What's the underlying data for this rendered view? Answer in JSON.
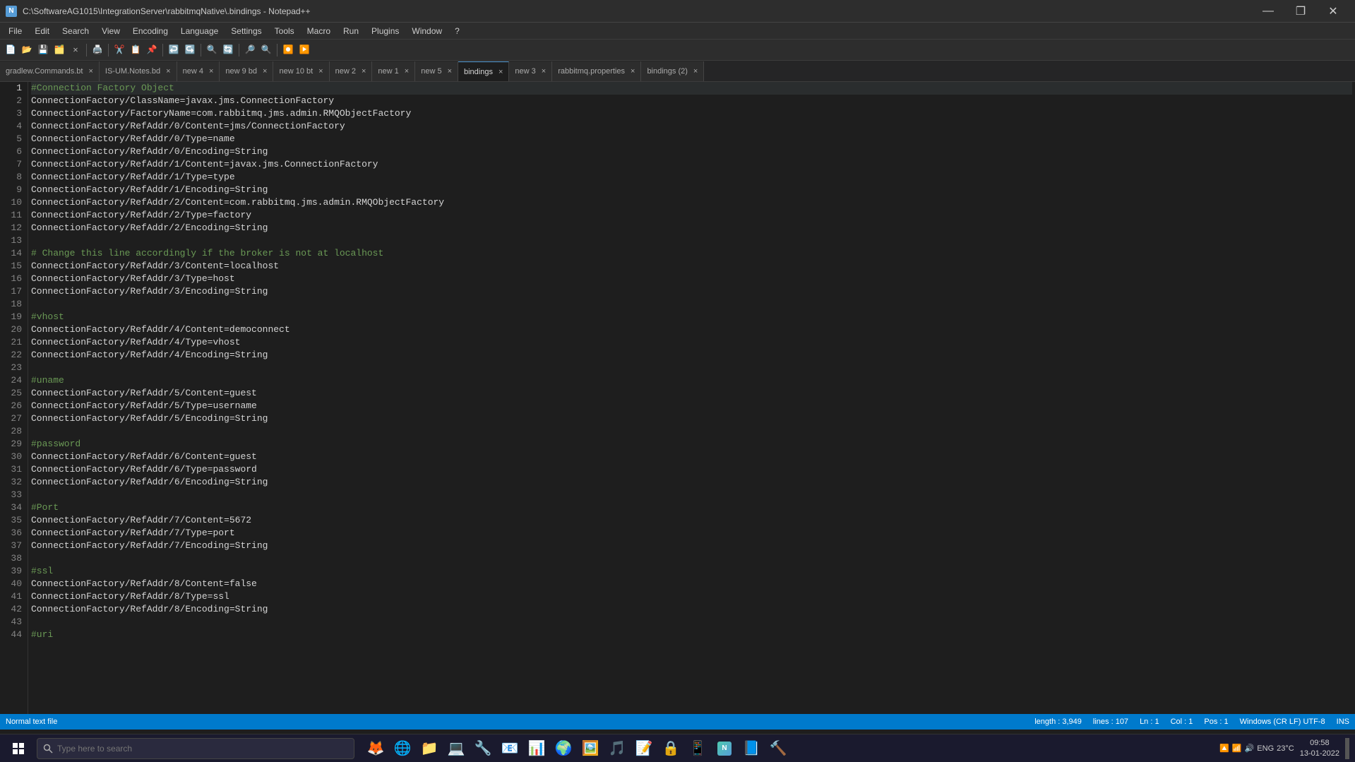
{
  "titleBar": {
    "title": "C:\\SoftwareAG1015\\IntegrationServer\\rabbitmqNative\\.bindings - Notepad++",
    "icon": "N",
    "minimize": "—",
    "maximize": "❐",
    "close": "✕"
  },
  "menuBar": {
    "items": [
      "File",
      "Edit",
      "Search",
      "View",
      "Encoding",
      "Language",
      "Settings",
      "Tools",
      "Macro",
      "Run",
      "Plugins",
      "Window",
      "?"
    ]
  },
  "tabs": [
    {
      "label": "gradlew.Commands.bt",
      "active": false,
      "closable": true
    },
    {
      "label": "IS-UM.Notes.bd",
      "active": false,
      "closable": true
    },
    {
      "label": "new 4",
      "active": false,
      "closable": true
    },
    {
      "label": "new 9 bd",
      "active": false,
      "closable": true
    },
    {
      "label": "new 10 bt",
      "active": false,
      "closable": true
    },
    {
      "label": "new 2",
      "active": false,
      "closable": true
    },
    {
      "label": "new 1",
      "active": false,
      "closable": true
    },
    {
      "label": "new 5",
      "active": false,
      "closable": true
    },
    {
      "label": "bindings",
      "active": true,
      "closable": true
    },
    {
      "label": "new 3",
      "active": false,
      "closable": true
    },
    {
      "label": "rabbitmq.properties",
      "active": false,
      "closable": true
    },
    {
      "label": "bindings (2)",
      "active": false,
      "closable": true
    }
  ],
  "codeLines": [
    {
      "num": 1,
      "text": "#Connection Factory Object",
      "type": "comment"
    },
    {
      "num": 2,
      "text": "ConnectionFactory/ClassName=javax.jms.ConnectionFactory",
      "type": "normal"
    },
    {
      "num": 3,
      "text": "ConnectionFactory/FactoryName=com.rabbitmq.jms.admin.RMQObjectFactory",
      "type": "normal"
    },
    {
      "num": 4,
      "text": "ConnectionFactory/RefAddr/0/Content=jms/ConnectionFactory",
      "type": "normal"
    },
    {
      "num": 5,
      "text": "ConnectionFactory/RefAddr/0/Type=name",
      "type": "normal"
    },
    {
      "num": 6,
      "text": "ConnectionFactory/RefAddr/0/Encoding=String",
      "type": "normal"
    },
    {
      "num": 7,
      "text": "ConnectionFactory/RefAddr/1/Content=javax.jms.ConnectionFactory",
      "type": "normal"
    },
    {
      "num": 8,
      "text": "ConnectionFactory/RefAddr/1/Type=type",
      "type": "normal"
    },
    {
      "num": 9,
      "text": "ConnectionFactory/RefAddr/1/Encoding=String",
      "type": "normal"
    },
    {
      "num": 10,
      "text": "ConnectionFactory/RefAddr/2/Content=com.rabbitmq.jms.admin.RMQObjectFactory",
      "type": "normal"
    },
    {
      "num": 11,
      "text": "ConnectionFactory/RefAddr/2/Type=factory",
      "type": "normal"
    },
    {
      "num": 12,
      "text": "ConnectionFactory/RefAddr/2/Encoding=String",
      "type": "normal"
    },
    {
      "num": 13,
      "text": "",
      "type": "normal"
    },
    {
      "num": 14,
      "text": "# Change this line accordingly if the broker is not at localhost",
      "type": "comment"
    },
    {
      "num": 15,
      "text": "ConnectionFactory/RefAddr/3/Content=localhost",
      "type": "normal"
    },
    {
      "num": 16,
      "text": "ConnectionFactory/RefAddr/3/Type=host",
      "type": "normal"
    },
    {
      "num": 17,
      "text": "ConnectionFactory/RefAddr/3/Encoding=String",
      "type": "normal"
    },
    {
      "num": 18,
      "text": "",
      "type": "normal"
    },
    {
      "num": 19,
      "text": "#vhost",
      "type": "comment"
    },
    {
      "num": 20,
      "text": "ConnectionFactory/RefAddr/4/Content=democonnect",
      "type": "normal"
    },
    {
      "num": 21,
      "text": "ConnectionFactory/RefAddr/4/Type=vhost",
      "type": "normal"
    },
    {
      "num": 22,
      "text": "ConnectionFactory/RefAddr/4/Encoding=String",
      "type": "normal"
    },
    {
      "num": 23,
      "text": "",
      "type": "normal"
    },
    {
      "num": 24,
      "text": "#uname",
      "type": "comment"
    },
    {
      "num": 25,
      "text": "ConnectionFactory/RefAddr/5/Content=guest",
      "type": "normal"
    },
    {
      "num": 26,
      "text": "ConnectionFactory/RefAddr/5/Type=username",
      "type": "normal"
    },
    {
      "num": 27,
      "text": "ConnectionFactory/RefAddr/5/Encoding=String",
      "type": "normal"
    },
    {
      "num": 28,
      "text": "",
      "type": "normal"
    },
    {
      "num": 29,
      "text": "#password",
      "type": "comment"
    },
    {
      "num": 30,
      "text": "ConnectionFactory/RefAddr/6/Content=guest",
      "type": "normal"
    },
    {
      "num": 31,
      "text": "ConnectionFactory/RefAddr/6/Type=password",
      "type": "normal"
    },
    {
      "num": 32,
      "text": "ConnectionFactory/RefAddr/6/Encoding=String",
      "type": "normal"
    },
    {
      "num": 33,
      "text": "",
      "type": "normal"
    },
    {
      "num": 34,
      "text": "#Port",
      "type": "comment"
    },
    {
      "num": 35,
      "text": "ConnectionFactory/RefAddr/7/Content=5672",
      "type": "normal"
    },
    {
      "num": 36,
      "text": "ConnectionFactory/RefAddr/7/Type=port",
      "type": "normal"
    },
    {
      "num": 37,
      "text": "ConnectionFactory/RefAddr/7/Encoding=String",
      "type": "normal"
    },
    {
      "num": 38,
      "text": "",
      "type": "normal"
    },
    {
      "num": 39,
      "text": "#ssl",
      "type": "comment"
    },
    {
      "num": 40,
      "text": "ConnectionFactory/RefAddr/8/Content=false",
      "type": "normal"
    },
    {
      "num": 41,
      "text": "ConnectionFactory/RefAddr/8/Type=ssl",
      "type": "normal"
    },
    {
      "num": 42,
      "text": "ConnectionFactory/RefAddr/8/Encoding=String",
      "type": "normal"
    },
    {
      "num": 43,
      "text": "",
      "type": "normal"
    },
    {
      "num": 44,
      "text": "#uri",
      "type": "comment"
    }
  ],
  "statusBar": {
    "fileType": "Normal text file",
    "length": "length : 3,949",
    "lines": "lines : 107",
    "ln": "Ln : 1",
    "col": "Col : 1",
    "pos": "Pos : 1",
    "lineEnding": "Windows (CR LF) UTF-8",
    "insertMode": "INS"
  },
  "taskbar": {
    "searchPlaceholder": "Type here to search",
    "time": "09:58",
    "date": "13-01-2022",
    "temp": "23°C",
    "lang": "ENG"
  }
}
